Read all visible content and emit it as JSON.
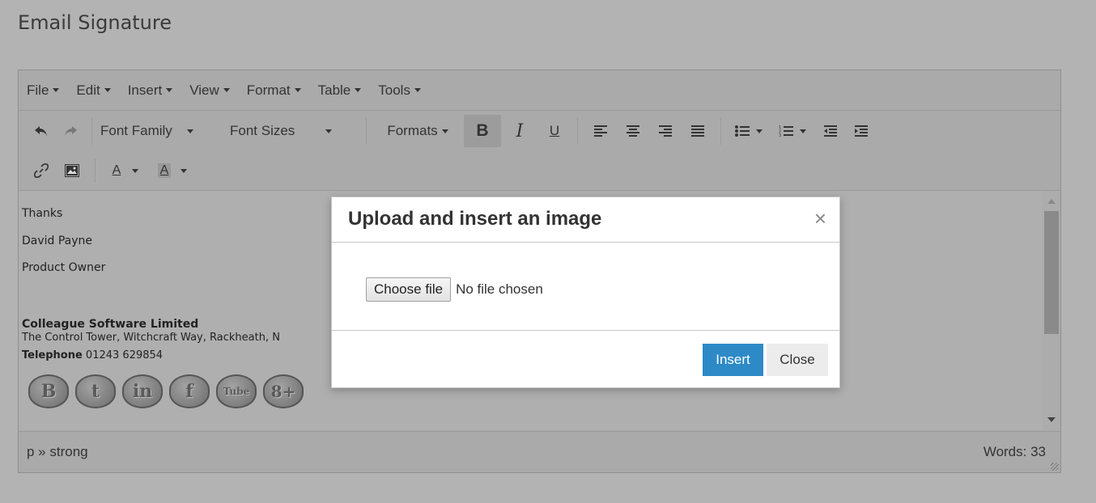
{
  "page": {
    "title": "Email Signature"
  },
  "menubar": {
    "items": [
      {
        "label": "File"
      },
      {
        "label": "Edit"
      },
      {
        "label": "Insert"
      },
      {
        "label": "View"
      },
      {
        "label": "Format"
      },
      {
        "label": "Table"
      },
      {
        "label": "Tools"
      }
    ]
  },
  "toolbar": {
    "font_family": "Font Family",
    "font_sizes": "Font Sizes",
    "formats": "Formats",
    "bold": "B",
    "italic": "I",
    "underline": "U",
    "text_color": "A",
    "bg_color": "A",
    "icons": [
      "undo-icon",
      "redo-icon",
      "align-left-icon",
      "align-center-icon",
      "align-right-icon",
      "align-justify-icon",
      "bullet-list-icon",
      "numbered-list-icon",
      "outdent-icon",
      "indent-icon",
      "link-icon",
      "image-icon"
    ]
  },
  "content": {
    "line1": "Thanks",
    "line2": "David Payne",
    "line3": "Product Owner",
    "company": "Colleague Software Limited",
    "address": "The Control Tower, Witchcraft Way, Rackheath, N",
    "telephone_label": "Telephone",
    "telephone_number": " 01243 629854",
    "social": [
      {
        "name": "blogger-icon",
        "glyph": "B"
      },
      {
        "name": "twitter-icon",
        "glyph": "t"
      },
      {
        "name": "linkedin-icon",
        "glyph": "in"
      },
      {
        "name": "facebook-icon",
        "glyph": "f"
      },
      {
        "name": "youtube-icon",
        "glyph": "Tube"
      },
      {
        "name": "googleplus-icon",
        "glyph": "8+"
      }
    ]
  },
  "statusbar": {
    "path": "p » strong",
    "words": "Words: 33"
  },
  "modal": {
    "title": "Upload and insert an image",
    "close_glyph": "×",
    "choose_file": "Choose file",
    "no_file": "No file chosen",
    "insert": "Insert",
    "close": "Close"
  },
  "colors": {
    "primary_button": "#2d8ac7",
    "overlay": "#b3b3b3"
  }
}
